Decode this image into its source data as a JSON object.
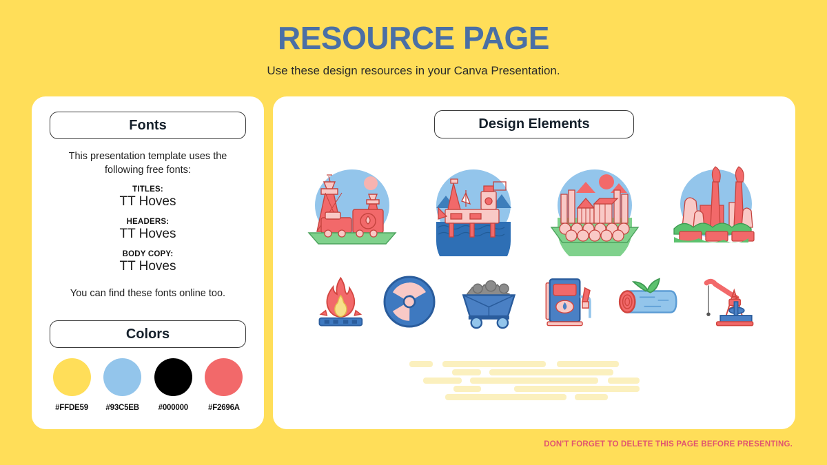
{
  "header": {
    "title": "RESOURCE PAGE",
    "subtitle": "Use these design resources in your Canva Presentation.",
    "title_color": "#4A6FA5"
  },
  "background_color": "#FFDE59",
  "fonts_panel": {
    "heading": "Fonts",
    "intro": "This presentation template uses the following free fonts:",
    "groups": [
      {
        "label": "TITLES:",
        "value": "TT Hoves"
      },
      {
        "label": "HEADERS:",
        "value": "TT Hoves"
      },
      {
        "label": "BODY COPY:",
        "value": "TT Hoves"
      }
    ],
    "outro": "You can find these fonts online too."
  },
  "colors_panel": {
    "heading": "Colors",
    "swatches": [
      {
        "name": "yellow-swatch",
        "hex": "#FFDE59"
      },
      {
        "name": "blue-swatch",
        "hex": "#93C5EB"
      },
      {
        "name": "black-swatch",
        "hex": "#000000"
      },
      {
        "name": "red-swatch",
        "hex": "#F2696A"
      }
    ]
  },
  "design_panel": {
    "heading": "Design Elements",
    "circle_illustrations": [
      {
        "name": "mining-train-scene",
        "alt": "red drilling towers with train on green ground"
      },
      {
        "name": "offshore-oil-rig-scene",
        "alt": "offshore oil platform on blue sea"
      },
      {
        "name": "timber-logging-scene",
        "alt": "sawmill buildings with stacked logs"
      },
      {
        "name": "power-plant-scene",
        "alt": "factory with smoking chimneys"
      }
    ],
    "icons": [
      {
        "name": "gas-flame-icon",
        "alt": "burning gas flame on burner"
      },
      {
        "name": "radioactive-icon",
        "alt": "nuclear radiation trefoil"
      },
      {
        "name": "coal-cart-icon",
        "alt": "mine cart filled with coal"
      },
      {
        "name": "fuel-pump-icon",
        "alt": "petrol station fuel dispenser"
      },
      {
        "name": "biomass-log-icon",
        "alt": "wood log with green leaves"
      },
      {
        "name": "oil-pumpjack-icon",
        "alt": "oil derrick pumpjack"
      }
    ],
    "decoration": {
      "name": "cloud-dashes-decoration"
    }
  },
  "footer": {
    "note": "DON'T FORGET TO DELETE THIS PAGE BEFORE PRESENTING.",
    "note_color": "#E0556F"
  }
}
